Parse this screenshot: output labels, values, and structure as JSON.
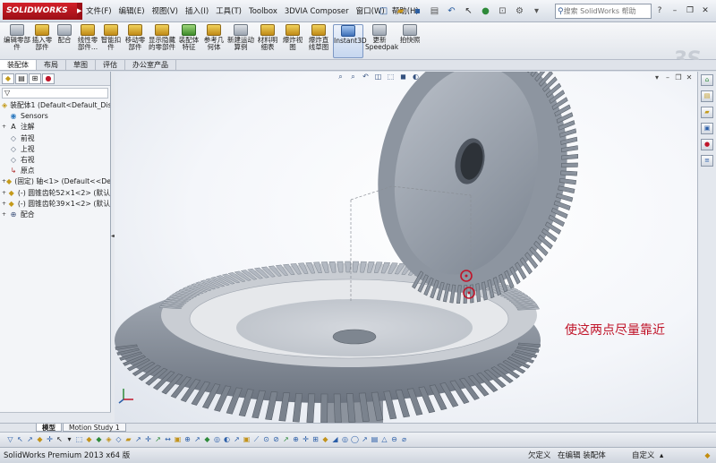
{
  "app": {
    "logo_text": "SOLIDWORKS",
    "menus": [
      "文件(F)",
      "编辑(E)",
      "视图(V)",
      "插入(I)",
      "工具(T)",
      "Toolbox",
      "3DVIA Composer",
      "窗口(W)",
      "帮助(H)"
    ],
    "search_placeholder": "搜索 SolidWorks 帮助",
    "watermark": "3S"
  },
  "commands": [
    {
      "label": "编辑零部件"
    },
    {
      "label": "插入零部件"
    },
    {
      "label": "配合"
    },
    {
      "label": "线性零部件..."
    },
    {
      "label": "智能扣件"
    },
    {
      "label": "移动零部件"
    },
    {
      "label": "显示隐藏的零部件"
    },
    {
      "label": "装配体特征"
    },
    {
      "label": "参考几何体"
    },
    {
      "label": "新建运动算例"
    },
    {
      "label": "材料明细表"
    },
    {
      "label": "爆炸视图"
    },
    {
      "label": "爆炸直线草图"
    },
    {
      "label": "Instant3D"
    },
    {
      "label": "更新Speedpak"
    },
    {
      "label": "拍快照"
    }
  ],
  "command_tabs": [
    "装配体",
    "布局",
    "草图",
    "评估",
    "办公室产品"
  ],
  "feature_tree": {
    "filter_icon": "filter-icon",
    "nodes": [
      {
        "label": "装配体1 (Default<Default_Dis",
        "icon": "assembly-icon",
        "expand": ""
      },
      {
        "label": "Sensors",
        "icon": "sensor-icon",
        "expand": ""
      },
      {
        "label": "注解",
        "icon": "annotation-icon",
        "expand": "+"
      },
      {
        "label": "前视",
        "icon": "plane-icon",
        "expand": ""
      },
      {
        "label": "上视",
        "icon": "plane-icon",
        "expand": ""
      },
      {
        "label": "右视",
        "icon": "plane-icon",
        "expand": ""
      },
      {
        "label": "原点",
        "icon": "origin-icon",
        "expand": ""
      },
      {
        "label": "(固定) 轴<1> (Default<<De",
        "icon": "part-icon",
        "expand": "+"
      },
      {
        "label": "(-) 圆锥齿轮52×1<2> (默认",
        "icon": "part-icon",
        "expand": "+"
      },
      {
        "label": "(-) 圆锥齿轮39×1<2> (默认",
        "icon": "part-icon",
        "expand": "+"
      },
      {
        "label": "配合",
        "icon": "mate-icon",
        "expand": "+"
      }
    ]
  },
  "graphics": {
    "annotation_text": "使这两点尽量靠近"
  },
  "model_tabs": [
    "模型",
    "Motion Study 1"
  ],
  "status": {
    "product": "SolidWorks Premium 2013 x64 版",
    "state1": "欠定义",
    "state2": "在编辑 装配体",
    "state3": "自定义"
  },
  "colors": {
    "annotation": "#c0152a",
    "gear": "#8e96a2",
    "background": "#f4f6fa"
  }
}
